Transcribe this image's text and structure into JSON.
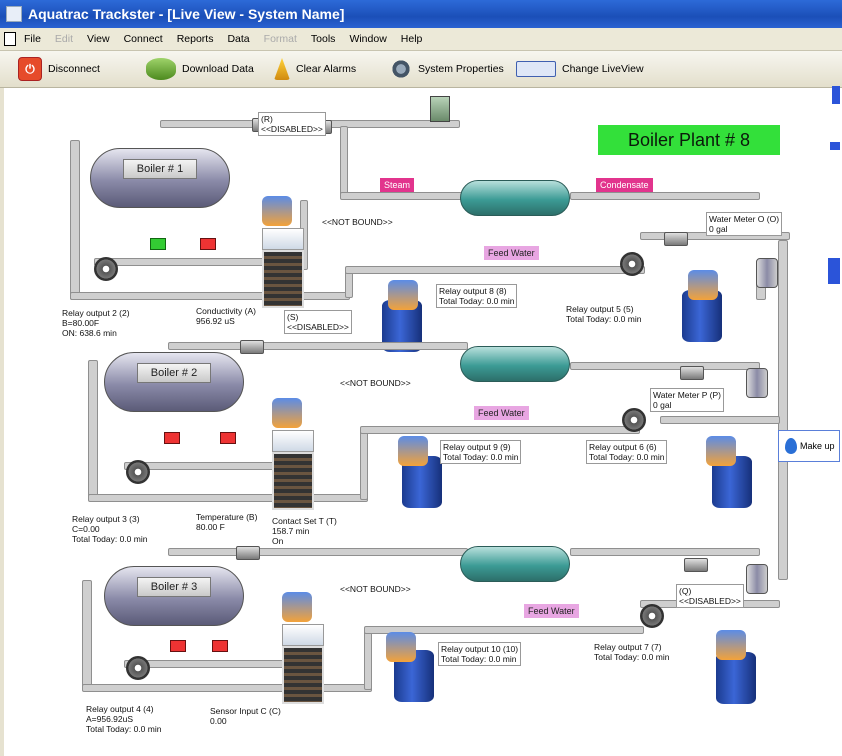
{
  "window": {
    "title": "Aquatrac Trackster - [Live View - System Name]"
  },
  "menu": {
    "items": [
      {
        "label": "File",
        "enabled": true
      },
      {
        "label": "Edit",
        "enabled": false
      },
      {
        "label": "View",
        "enabled": true
      },
      {
        "label": "Connect",
        "enabled": true
      },
      {
        "label": "Reports",
        "enabled": true
      },
      {
        "label": "Data",
        "enabled": true
      },
      {
        "label": "Format",
        "enabled": false
      },
      {
        "label": "Tools",
        "enabled": true
      },
      {
        "label": "Window",
        "enabled": true
      },
      {
        "label": "Help",
        "enabled": true
      }
    ]
  },
  "toolbar": {
    "disconnect": "Disconnect",
    "download": "Download Data",
    "clear_alarms": "Clear Alarms",
    "system_properties": "System Properties",
    "change_liveview": "Change LiveView"
  },
  "plant": {
    "title": "Boiler Plant # 8"
  },
  "boilers": [
    "Boiler # 1",
    "Boiler # 2",
    "Boiler # 3"
  ],
  "tags": {
    "steam": "Steam",
    "condensate": "Condensate",
    "feed_water": "Feed Water"
  },
  "labels": {
    "disabled_r": "(R)\n<<DISABLED>>",
    "disabled_s": "(S)\n<<DISABLED>>",
    "disabled_q": "(Q)\n<<DISABLED>>",
    "not_bound": "<<NOT BOUND>>",
    "relay2": "Relay output 2 (2)\nB=80.00F\nON: 638.6 min",
    "conductivity": "Conductivity (A)\n956.92 uS",
    "relay8": "Relay output 8 (8)\nTotal Today: 0.0 min",
    "relay5": "Relay output 5 (5)\nTotal Today: 0.0 min",
    "water_meter_o": "Water Meter O (O)\n0 gal",
    "water_meter_p": "Water Meter P (P)\n0 gal",
    "relay9": "Relay output 9 (9)\nTotal Today: 0.0 min",
    "relay6": "Relay output 6 (6)\nTotal Today: 0.0 min",
    "relay3": "Relay output 3 (3)\nC=0.00\nTotal Today: 0.0 min",
    "temperature": "Temperature (B)\n80.00 F",
    "contact_t": "Contact Set T (T)\n158.7 min\nOn",
    "relay10": "Relay output 10 (10)\nTotal Today: 0.0 min",
    "relay7": "Relay output 7 (7)\nTotal Today: 0.0 min",
    "relay4": "Relay output 4 (4)\nA=956.92uS\nTotal Today: 0.0 min",
    "sensor_c": "Sensor Input C (C)\n0.00",
    "makeup": "Make up"
  },
  "colors": {
    "plant_title_bg": "#33e03a",
    "steam": "#e2348d",
    "feed_water": "#e8a6e2",
    "titlebar": "#2d6ad8"
  }
}
